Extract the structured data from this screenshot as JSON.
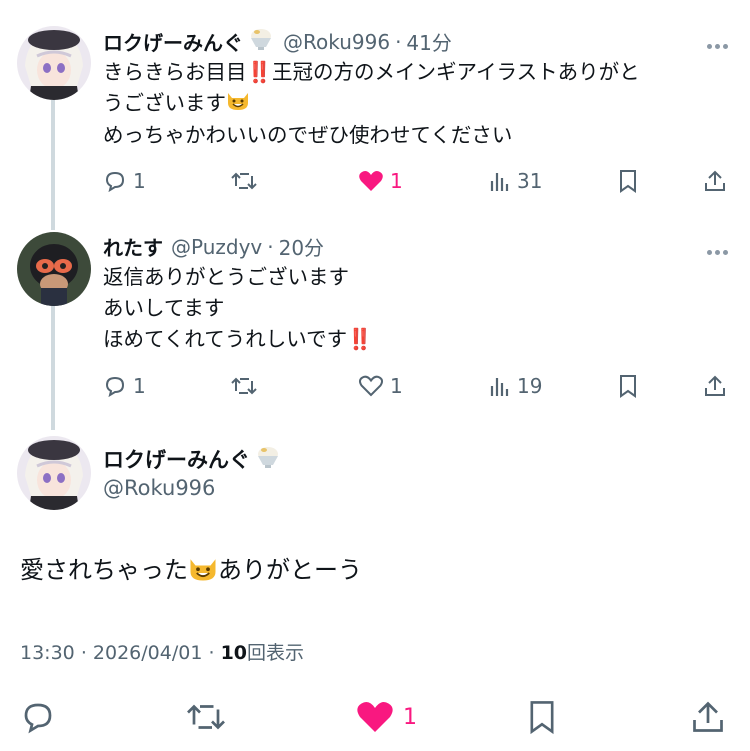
{
  "reply1": {
    "name": "ロクげーみんぐ",
    "badge_icon": "shaved-ice-icon",
    "handle": "@Roku996",
    "sep": "·",
    "time": "41分",
    "line1_a": "きらきらお目目",
    "line1_bang": "‼️",
    "line1_b": "王冠の方のメインギアイラストありがと",
    "line2_a": "うございます",
    "line2_emoji": "smiling-cat-icon",
    "line3": "めっちゃかわいいのでぜひ使わせてください",
    "replies": "1",
    "likes": "1",
    "views": "31",
    "liked": true
  },
  "reply2": {
    "name": "れたす",
    "handle": "@Puzdyv",
    "sep": "·",
    "time": "20分",
    "line1": "返信ありがとうございます",
    "line2": "あいしてます",
    "line3_a": "ほめてくれてうれしいです",
    "line3_bang": "‼️",
    "replies": "1",
    "likes": "1",
    "views": "19",
    "liked": false
  },
  "main": {
    "name": "ロクげーみんぐ",
    "handle": "@Roku996",
    "text_a": "愛されちゃった",
    "text_b": "ありがとーう",
    "time": "13:30",
    "sep1": "·",
    "date": "2026/04/01",
    "sep2": "·",
    "views": "10",
    "views_label": "回表示",
    "likes": "1"
  },
  "colors": {
    "like": "#f91880",
    "muted": "#536471",
    "thread_line": "#cfd9de"
  }
}
